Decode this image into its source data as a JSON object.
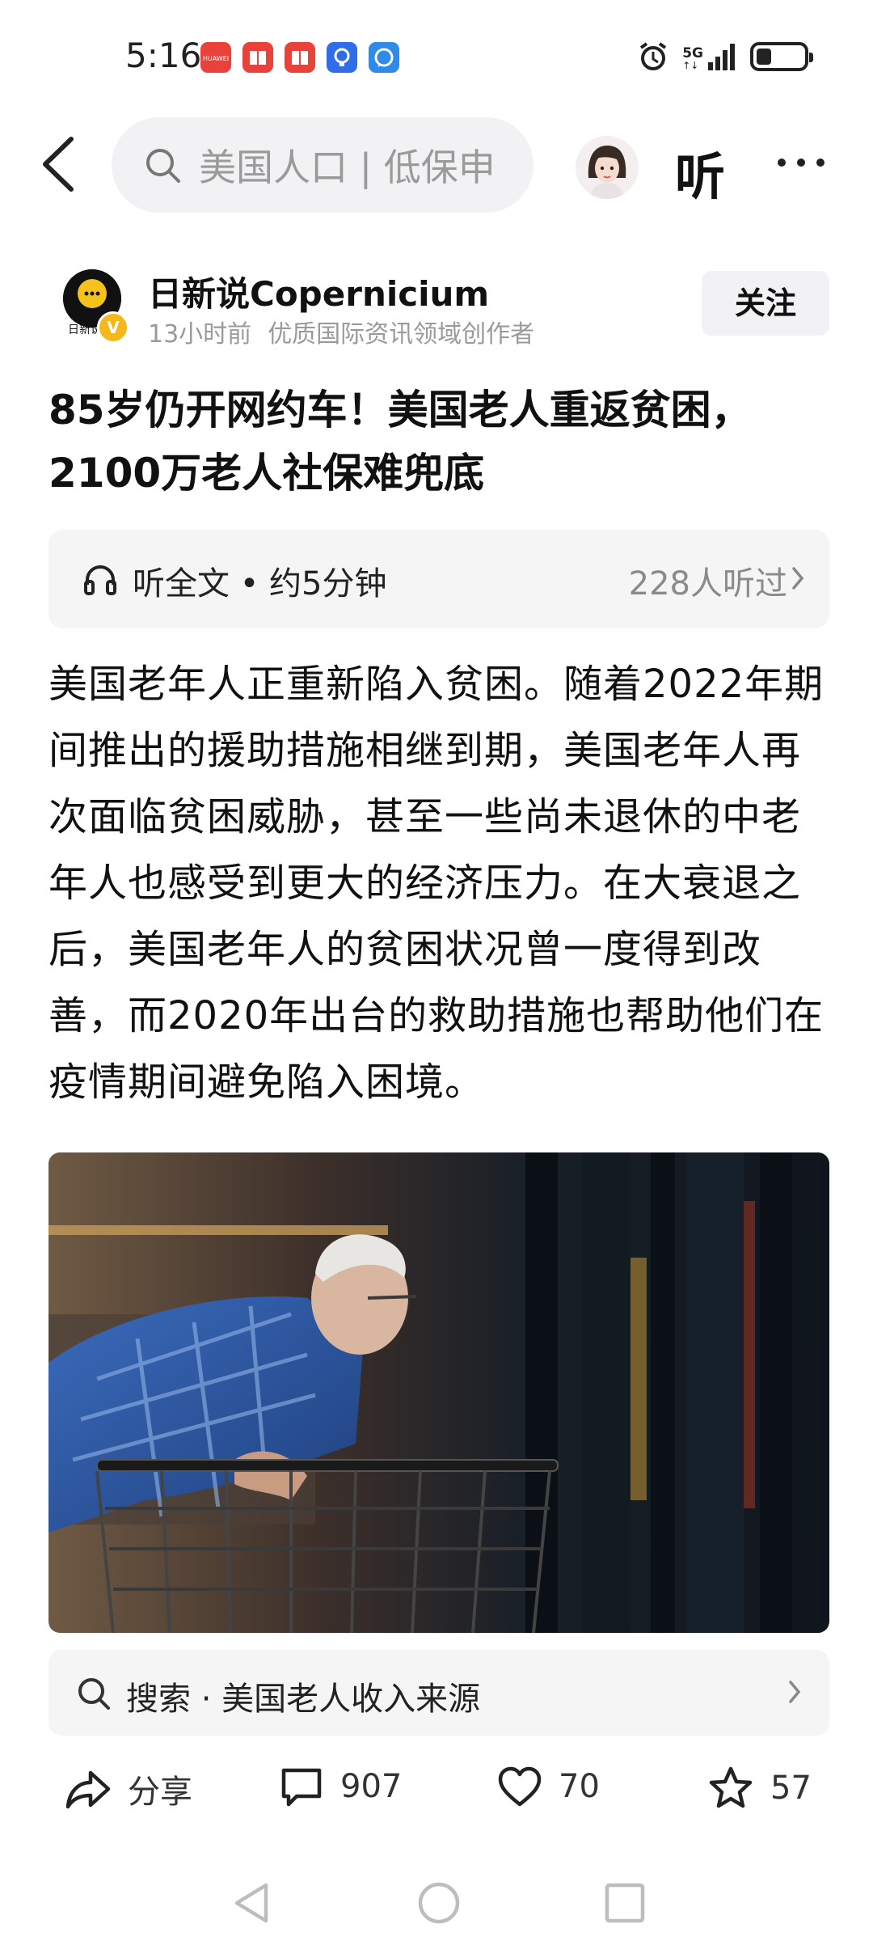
{
  "status_bar": {
    "time": "5:16",
    "network": "5G",
    "notif_colors": [
      "#e8423a",
      "#e8423a",
      "#e8423a",
      "#2f6ee8",
      "#2f8ae8"
    ]
  },
  "top_nav": {
    "search_text": "美国人口 | 低保申",
    "listen_label": "听"
  },
  "author": {
    "logo_text": "日新说",
    "name": "日新说Copernicium",
    "time_ago": "13小时前",
    "tagline": "优质国际资讯领域创作者",
    "follow_label": "关注"
  },
  "article": {
    "title_line1": "85岁仍开网约车！美国老人重返贫困，",
    "title_line2": "2100万老人社保难兜底",
    "listen_card": {
      "label": "听全文 • 约5分钟",
      "count": "228人听过"
    },
    "paragraph": "美国老年人正重新陷入贫困。随着2022年期间推出的援助措施相继到期，美国老年人再次面临贫困威胁，甚至一些尚未退休的中老年人也感受到更大的经济压力。在大衰退之后，美国老年人的贫困状况曾一度得到改善，而2020年出台的救助措施也帮助他们在疫情期间避免陷入困境。"
  },
  "related_search": {
    "text": "搜索 · 美国老人收入来源"
  },
  "actions": {
    "share_label": "分享",
    "comments": "907",
    "likes": "70",
    "favorites": "57"
  }
}
